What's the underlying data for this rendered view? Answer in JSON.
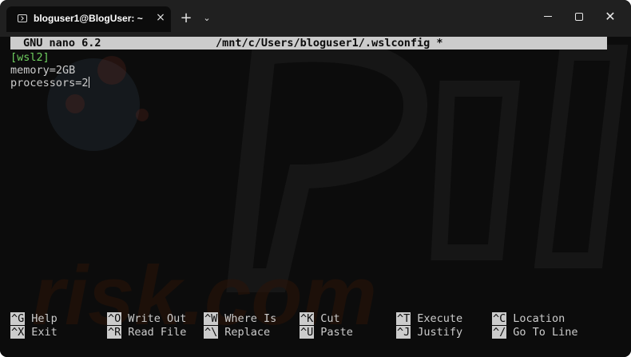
{
  "window": {
    "tab_title": "bloguser1@BlogUser: ~",
    "close_tab_label": "×",
    "new_tab_label": "+",
    "dropdown_label": "⌄",
    "close_label": "✕"
  },
  "nano": {
    "version": "GNU nano 6.2",
    "file_path": "/mnt/c/Users/bloguser1/.wslconfig *"
  },
  "file_lines": [
    "[wsl2]",
    "memory=2GB",
    "processors=2"
  ],
  "shortcuts": [
    {
      "key": "^G",
      "label": "Help"
    },
    {
      "key": "^X",
      "label": "Exit"
    },
    {
      "key": "^O",
      "label": "Write Out"
    },
    {
      "key": "^R",
      "label": "Read File"
    },
    {
      "key": "^W",
      "label": "Where Is"
    },
    {
      "key": "^\\",
      "label": "Replace"
    },
    {
      "key": "^K",
      "label": "Cut"
    },
    {
      "key": "^U",
      "label": "Paste"
    },
    {
      "key": "^T",
      "label": "Execute"
    },
    {
      "key": "^J",
      "label": "Justify"
    },
    {
      "key": "^C",
      "label": "Location"
    },
    {
      "key": "^/",
      "label": "Go To Line"
    }
  ],
  "colors": {
    "terminal_bg": "#0c0c0c",
    "titlebar_bg": "#202020",
    "text": "#cccccc",
    "section_header": "#6fcf5f"
  },
  "watermark": "risk.com"
}
